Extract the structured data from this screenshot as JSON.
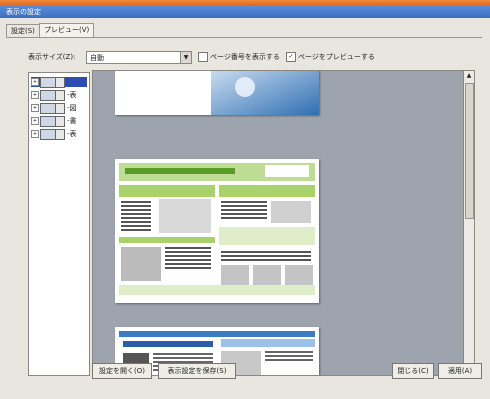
{
  "window": {
    "title": "表示の設定"
  },
  "tabs": [
    {
      "label": "設定(S)"
    },
    {
      "label": "プレビュー(V)"
    }
  ],
  "options": {
    "size_label": "表示サイズ(Z):",
    "size_value": "自動",
    "checkbox1_label": "ページ番号を表示する",
    "checkbox2_label": "ページをプレビューする",
    "checkbox2_checked": "✓"
  },
  "tree": [
    {
      "expander": "+",
      "suffix": ""
    },
    {
      "expander": "+",
      "suffix": "-表"
    },
    {
      "expander": "+",
      "suffix": "-図"
    },
    {
      "expander": "+",
      "suffix": "-書"
    },
    {
      "expander": "+",
      "suffix": "-表"
    }
  ],
  "buttons": {
    "settings": "設定を開く(O)",
    "show_settings": "表示設定を保存(S)",
    "cancel": "閉じる(C)",
    "apply": "適用(A)"
  },
  "colors": {
    "accent": "#e56a1c",
    "title": "#3d6fc0",
    "page_green": "#8bbf3c",
    "preview_bg": "#9ea4ad"
  }
}
